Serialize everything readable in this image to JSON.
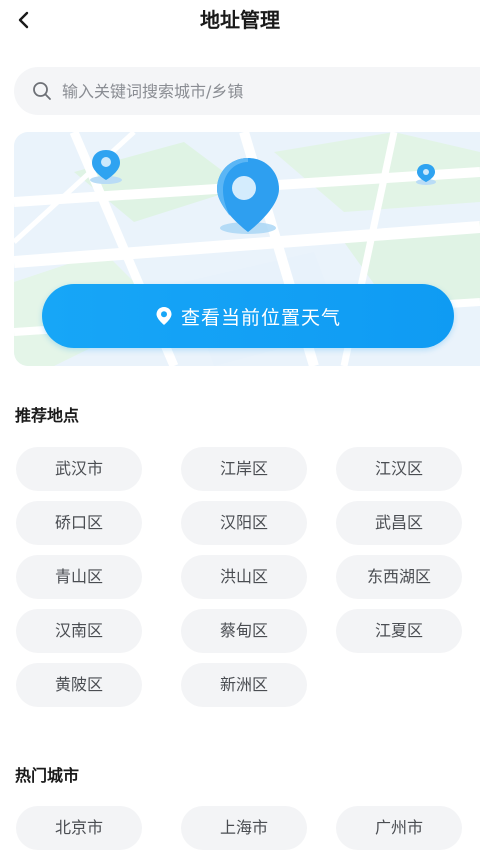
{
  "header": {
    "title": "地址管理",
    "back_icon": "chevron-left-icon"
  },
  "search": {
    "placeholder": "输入关键词搜索城市/乡镇",
    "value": "",
    "icon": "search-icon"
  },
  "map": {
    "locate_button_label": "查看当前位置天气",
    "locate_icon": "location-pin-icon",
    "accent_color": "#1aa3f5"
  },
  "recommended": {
    "title": "推荐地点",
    "items": [
      "武汉市",
      "江岸区",
      "江汉区",
      "硚口区",
      "汉阳区",
      "武昌区",
      "青山区",
      "洪山区",
      "东西湖区",
      "汉南区",
      "蔡甸区",
      "江夏区",
      "黄陂区",
      "新洲区"
    ]
  },
  "hot_cities": {
    "title": "热门城市",
    "items": [
      "北京市",
      "上海市",
      "广州市"
    ]
  }
}
